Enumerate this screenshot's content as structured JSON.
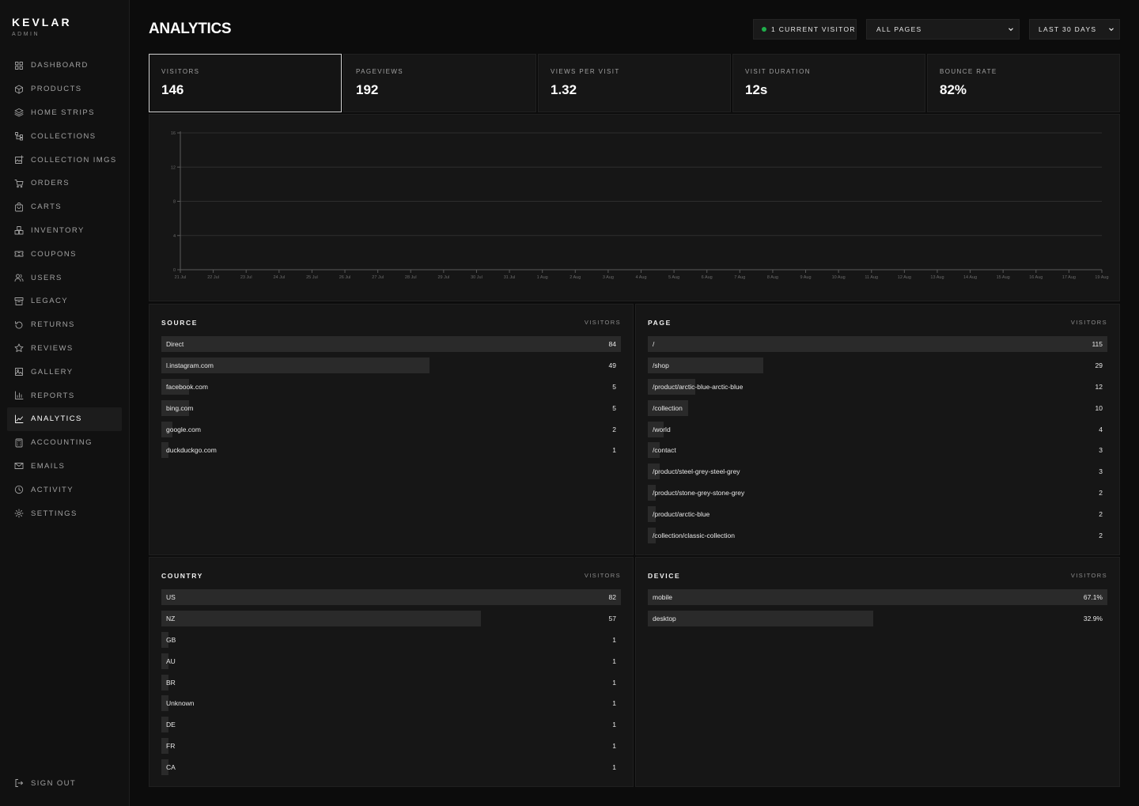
{
  "brand": {
    "name": "KEVLAR",
    "sub": "ADMIN"
  },
  "nav": [
    {
      "label": "DASHBOARD",
      "icon": "grid-icon"
    },
    {
      "label": "PRODUCTS",
      "icon": "box-icon"
    },
    {
      "label": "HOME STRIPS",
      "icon": "layers-icon"
    },
    {
      "label": "COLLECTIONS",
      "icon": "tree-icon"
    },
    {
      "label": "COLLECTION IMGS",
      "icon": "image-plus-icon"
    },
    {
      "label": "ORDERS",
      "icon": "cart-icon"
    },
    {
      "label": "CARTS",
      "icon": "bag-icon"
    },
    {
      "label": "INVENTORY",
      "icon": "boxes-icon"
    },
    {
      "label": "COUPONS",
      "icon": "ticket-icon"
    },
    {
      "label": "USERS",
      "icon": "users-icon"
    },
    {
      "label": "LEGACY",
      "icon": "archive-icon"
    },
    {
      "label": "RETURNS",
      "icon": "rotate-icon"
    },
    {
      "label": "REVIEWS",
      "icon": "star-icon"
    },
    {
      "label": "GALLERY",
      "icon": "image-icon"
    },
    {
      "label": "REPORTS",
      "icon": "bar-chart-icon"
    },
    {
      "label": "ANALYTICS",
      "icon": "line-chart-icon",
      "active": true
    },
    {
      "label": "ACCOUNTING",
      "icon": "calculator-icon"
    },
    {
      "label": "EMAILS",
      "icon": "mail-icon"
    },
    {
      "label": "ACTIVITY",
      "icon": "clock-icon"
    },
    {
      "label": "SETTINGS",
      "icon": "gear-icon"
    }
  ],
  "signout": "SIGN OUT",
  "header": {
    "title": "ANALYTICS",
    "current_visitor": "1 CURRENT VISITOR",
    "page_filter": "ALL PAGES",
    "range_filter": "LAST 30 DAYS"
  },
  "stats": [
    {
      "label": "VISITORS",
      "value": "146"
    },
    {
      "label": "PAGEVIEWS",
      "value": "192"
    },
    {
      "label": "VIEWS PER VISIT",
      "value": "1.32"
    },
    {
      "label": "VISIT DURATION",
      "value": "12s"
    },
    {
      "label": "BOUNCE RATE",
      "value": "82%"
    }
  ],
  "chart_data": {
    "type": "line",
    "title": "",
    "xlabel": "",
    "ylabel": "",
    "y_ticks": [
      "0",
      "4",
      "8",
      "12",
      "16"
    ],
    "ylim": [
      0,
      16
    ],
    "x": [
      "21 Jul",
      "22 Jul",
      "23 Jul",
      "24 Jul",
      "25 Jul",
      "26 Jul",
      "27 Jul",
      "28 Jul",
      "29 Jul",
      "30 Jul",
      "31 Jul",
      "1 Aug",
      "2 Aug",
      "3 Aug",
      "4 Aug",
      "5 Aug",
      "6 Aug",
      "7 Aug",
      "8 Aug",
      "9 Aug",
      "10 Aug",
      "11 Aug",
      "12 Aug",
      "13 Aug",
      "14 Aug",
      "15 Aug",
      "16 Aug",
      "17 Aug",
      "19 Aug"
    ],
    "grid": true
  },
  "panels": {
    "source": {
      "title": "SOURCE",
      "metric": "VISITORS",
      "rows": [
        {
          "label": "Direct",
          "value": "84",
          "fraction": 1.0
        },
        {
          "label": "l.instagram.com",
          "value": "49",
          "fraction": 0.583
        },
        {
          "label": "facebook.com",
          "value": "5",
          "fraction": 0.06
        },
        {
          "label": "bing.com",
          "value": "5",
          "fraction": 0.06
        },
        {
          "label": "google.com",
          "value": "2",
          "fraction": 0.024
        },
        {
          "label": "duckduckgo.com",
          "value": "1",
          "fraction": 0.012
        }
      ]
    },
    "page": {
      "title": "PAGE",
      "metric": "VISITORS",
      "rows": [
        {
          "label": "/",
          "value": "115",
          "fraction": 1.0
        },
        {
          "label": "/shop",
          "value": "29",
          "fraction": 0.252
        },
        {
          "label": "/product/arctic-blue-arctic-blue",
          "value": "12",
          "fraction": 0.104
        },
        {
          "label": "/collection",
          "value": "10",
          "fraction": 0.087
        },
        {
          "label": "/world",
          "value": "4",
          "fraction": 0.035
        },
        {
          "label": "/contact",
          "value": "3",
          "fraction": 0.026
        },
        {
          "label": "/product/steel-grey-steel-grey",
          "value": "3",
          "fraction": 0.026
        },
        {
          "label": "/product/stone-grey-stone-grey",
          "value": "2",
          "fraction": 0.017
        },
        {
          "label": "/product/arctic-blue",
          "value": "2",
          "fraction": 0.017
        },
        {
          "label": "/collection/classic-collection",
          "value": "2",
          "fraction": 0.017
        }
      ]
    },
    "country": {
      "title": "COUNTRY",
      "metric": "VISITORS",
      "rows": [
        {
          "label": "US",
          "value": "82",
          "fraction": 1.0
        },
        {
          "label": "NZ",
          "value": "57",
          "fraction": 0.695
        },
        {
          "label": "GB",
          "value": "1",
          "fraction": 0.012
        },
        {
          "label": "AU",
          "value": "1",
          "fraction": 0.012
        },
        {
          "label": "BR",
          "value": "1",
          "fraction": 0.012
        },
        {
          "label": "Unknown",
          "value": "1",
          "fraction": 0.012
        },
        {
          "label": "DE",
          "value": "1",
          "fraction": 0.012
        },
        {
          "label": "FR",
          "value": "1",
          "fraction": 0.012
        },
        {
          "label": "CA",
          "value": "1",
          "fraction": 0.012
        }
      ]
    },
    "device": {
      "title": "DEVICE",
      "metric": "VISITORS",
      "rows": [
        {
          "label": "mobile",
          "value": "67.1%",
          "fraction": 1.0
        },
        {
          "label": "desktop",
          "value": "32.9%",
          "fraction": 0.49
        }
      ]
    }
  }
}
